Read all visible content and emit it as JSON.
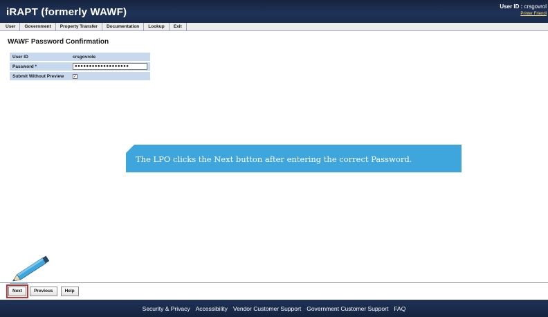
{
  "header": {
    "app_title": "iRAPT (formerly WAWF)",
    "user_id_label": "User ID :",
    "user_id_value": "crsgovrol",
    "printer_friendly": "Printer Friendl"
  },
  "menu": [
    {
      "label": "User"
    },
    {
      "label": "Government"
    },
    {
      "label": "Property Transfer"
    },
    {
      "label": "Documentation"
    },
    {
      "label": "Lookup"
    },
    {
      "label": "Exit"
    }
  ],
  "page_title": "WAWF Password Confirmation",
  "form": {
    "user_id_label": "User ID",
    "user_id_value": "crsgovrole",
    "password_label": "Password *",
    "password_value": "●●●●●●●●●●●●●●●●●●●",
    "submit_without_preview_label": "Submit Without Preview",
    "submit_without_preview_checked": "✓"
  },
  "callout": {
    "text": "The LPO clicks the Next button after entering the correct Password."
  },
  "buttons": {
    "next": "Next",
    "previous": "Previous",
    "help": "Help"
  },
  "footer": [
    {
      "label": "Security & Privacy"
    },
    {
      "label": "Accessibility"
    },
    {
      "label": "Vendor Customer Support"
    },
    {
      "label": "Government Customer Support"
    },
    {
      "label": "FAQ"
    }
  ],
  "colors": {
    "header_bg": "#1f3358",
    "form_row_bg": "#c8d9ee",
    "callout_bg": "#3ea6dd",
    "highlight": "#d12b2b"
  },
  "icons": {
    "pencil": "pencil-icon"
  }
}
